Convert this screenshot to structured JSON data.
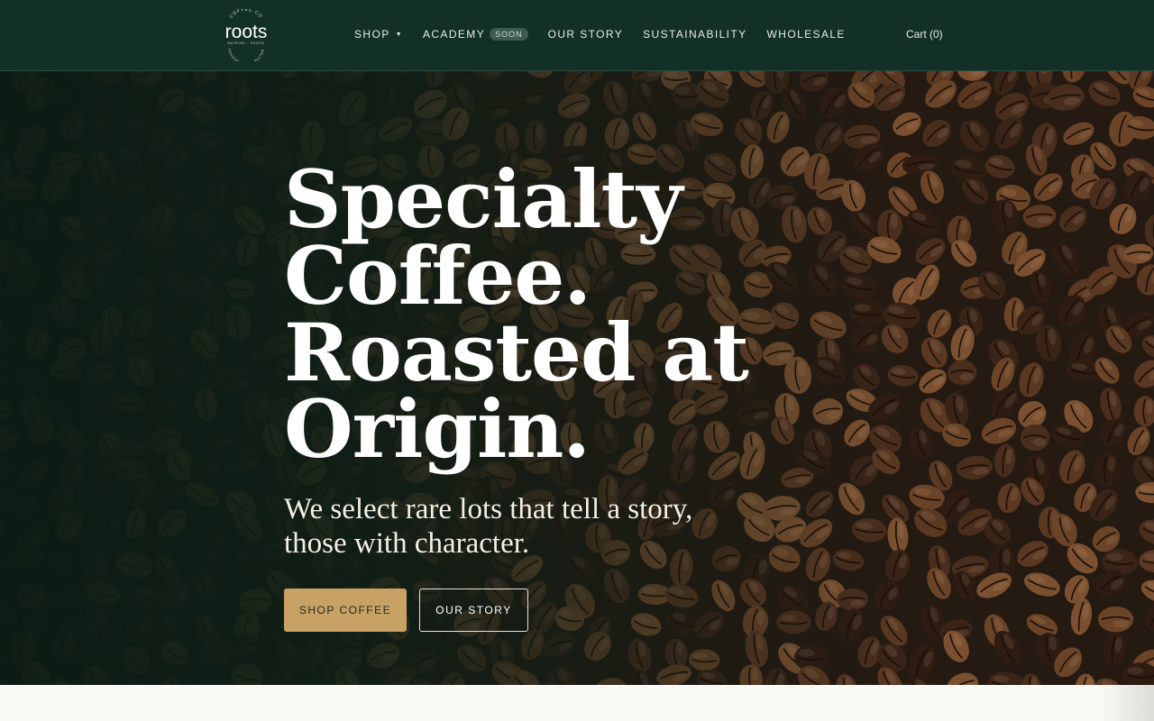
{
  "brand": {
    "name": "roots",
    "logo_arc_top": "COFFEE CO",
    "logo_subline": "NAIROBI · KENYA",
    "logo_arc_bottom": "ROASTED IN CHARACTER"
  },
  "nav": {
    "items": [
      {
        "label": "Shop",
        "has_dropdown": true
      },
      {
        "label": "Academy",
        "badge": "Soon"
      },
      {
        "label": "Our Story"
      },
      {
        "label": "Sustainability"
      },
      {
        "label": "Wholesale"
      }
    ],
    "cart_label": "Cart (0)"
  },
  "hero": {
    "title_lines": [
      "Specialty",
      "Coffee.",
      "Roasted at",
      "Origin."
    ],
    "subtitle_line1": "We select rare lots that tell a story,",
    "subtitle_line2": "those with character.",
    "primary_cta": "Shop Coffee",
    "secondary_cta": "Our Story"
  },
  "colors": {
    "header_bg": "#123027",
    "accent_gold": "#c8a164",
    "hero_overlay": "#0b1d15"
  }
}
